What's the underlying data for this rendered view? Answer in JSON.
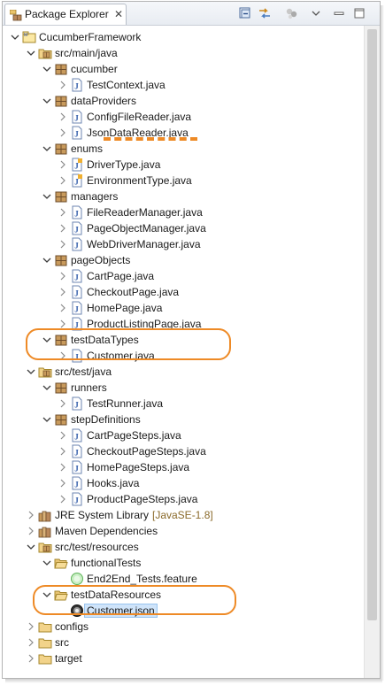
{
  "view": {
    "title": "Package Explorer",
    "close_glyph": "✕",
    "toolbar": [
      {
        "name": "collapse-all-icon"
      },
      {
        "name": "link-with-editor-icon"
      },
      {
        "name": "focus-on-active-task-icon"
      },
      {
        "name": "view-menu-chevron-icon"
      },
      {
        "name": "minimize-icon"
      },
      {
        "name": "maximize-icon"
      }
    ]
  },
  "tree": [
    {
      "label": "CucumberFramework",
      "icon": "project-icon",
      "expanded": true,
      "level": 0
    },
    {
      "label": "src/main/java",
      "icon": "source-folder-icon",
      "expanded": true,
      "level": 1
    },
    {
      "label": "cucumber",
      "icon": "package-icon",
      "expanded": true,
      "level": 2
    },
    {
      "label": "TestContext.java",
      "icon": "java-file-icon",
      "expanded": false,
      "level": 3
    },
    {
      "label": "dataProviders",
      "icon": "package-icon",
      "expanded": true,
      "level": 2
    },
    {
      "label": "ConfigFileReader.java",
      "icon": "java-file-icon",
      "expanded": false,
      "level": 3
    },
    {
      "label": "JsonDataReader.java",
      "icon": "java-file-icon",
      "expanded": false,
      "level": 3
    },
    {
      "label": "enums",
      "icon": "package-icon",
      "expanded": true,
      "level": 2
    },
    {
      "label": "DriverType.java",
      "icon": "java-enum-file-icon",
      "expanded": false,
      "level": 3
    },
    {
      "label": "EnvironmentType.java",
      "icon": "java-enum-file-icon",
      "expanded": false,
      "level": 3
    },
    {
      "label": "managers",
      "icon": "package-icon",
      "expanded": true,
      "level": 2
    },
    {
      "label": "FileReaderManager.java",
      "icon": "java-file-icon",
      "expanded": false,
      "level": 3
    },
    {
      "label": "PageObjectManager.java",
      "icon": "java-file-icon",
      "expanded": false,
      "level": 3
    },
    {
      "label": "WebDriverManager.java",
      "icon": "java-file-icon",
      "expanded": false,
      "level": 3
    },
    {
      "label": "pageObjects",
      "icon": "package-icon",
      "expanded": true,
      "level": 2
    },
    {
      "label": "CartPage.java",
      "icon": "java-file-icon",
      "expanded": false,
      "level": 3
    },
    {
      "label": "CheckoutPage.java",
      "icon": "java-file-icon",
      "expanded": false,
      "level": 3
    },
    {
      "label": "HomePage.java",
      "icon": "java-file-icon",
      "expanded": false,
      "level": 3
    },
    {
      "label": "ProductListingPage.java",
      "icon": "java-file-icon",
      "expanded": false,
      "level": 3
    },
    {
      "label": "testDataTypes",
      "icon": "package-icon",
      "expanded": true,
      "level": 2
    },
    {
      "label": "Customer.java",
      "icon": "java-file-icon",
      "expanded": false,
      "level": 3
    },
    {
      "label": "src/test/java",
      "icon": "source-folder-icon",
      "expanded": true,
      "level": 1
    },
    {
      "label": "runners",
      "icon": "package-icon",
      "expanded": true,
      "level": 2
    },
    {
      "label": "TestRunner.java",
      "icon": "java-file-icon",
      "expanded": false,
      "level": 3
    },
    {
      "label": "stepDefinitions",
      "icon": "package-icon",
      "expanded": true,
      "level": 2
    },
    {
      "label": "CartPageSteps.java",
      "icon": "java-file-icon",
      "expanded": false,
      "level": 3
    },
    {
      "label": "CheckoutPageSteps.java",
      "icon": "java-file-icon",
      "expanded": false,
      "level": 3
    },
    {
      "label": "HomePageSteps.java",
      "icon": "java-file-icon",
      "expanded": false,
      "level": 3
    },
    {
      "label": "Hooks.java",
      "icon": "java-file-icon",
      "expanded": false,
      "level": 3
    },
    {
      "label": "ProductPageSteps.java",
      "icon": "java-file-icon",
      "expanded": false,
      "level": 3
    },
    {
      "label": "JRE System Library",
      "decoration": "[JavaSE-1.8]",
      "icon": "library-icon",
      "expanded": false,
      "level": 1
    },
    {
      "label": "Maven Dependencies",
      "icon": "library-icon",
      "expanded": false,
      "level": 1
    },
    {
      "label": "src/test/resources",
      "icon": "source-folder-icon",
      "expanded": true,
      "level": 1
    },
    {
      "label": "functionalTests",
      "icon": "folder-open-icon",
      "expanded": true,
      "level": 2
    },
    {
      "label": "End2End_Tests.feature",
      "icon": "feature-file-icon",
      "level": 3,
      "leaf": true
    },
    {
      "label": "testDataResources",
      "icon": "folder-open-icon",
      "expanded": true,
      "level": 2
    },
    {
      "label": "Customer.json",
      "icon": "json-file-icon",
      "level": 3,
      "leaf": true,
      "selected": true
    },
    {
      "label": "configs",
      "icon": "folder-icon",
      "expanded": false,
      "level": 1
    },
    {
      "label": "src",
      "icon": "folder-icon",
      "expanded": false,
      "level": 1
    },
    {
      "label": "target",
      "icon": "folder-icon",
      "expanded": false,
      "level": 1
    }
  ],
  "colors": {
    "annotation": "#ee8a26",
    "selection": "#cfe4fa"
  }
}
